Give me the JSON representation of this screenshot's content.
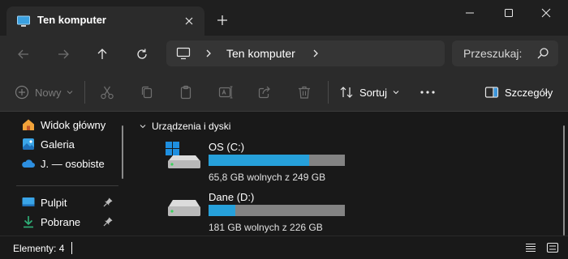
{
  "window": {
    "tab_title": "Ten komputer",
    "new_tab_symbol": "+",
    "icons": {
      "tab": "this-pc-icon",
      "close": "close-icon",
      "minimize": "minimize-icon",
      "maximize": "maximize-icon",
      "chevron": "chevron-down-icon"
    }
  },
  "nav": {
    "address": {
      "location": "Ten komputer"
    },
    "search_placeholder": "Przeszukaj:",
    "icons": [
      "back-arrow-icon",
      "forward-arrow-icon",
      "up-arrow-icon",
      "refresh-icon"
    ]
  },
  "toolbar": {
    "new_label": "Nowy",
    "sort_label": "Sortuj",
    "details_label": "Szczegóły",
    "disabled_icons": [
      "cut-icon",
      "copy-icon",
      "paste-icon",
      "rename-icon",
      "share-icon",
      "delete-icon"
    ]
  },
  "sidebar": {
    "items": [
      {
        "label": "Widok główny",
        "icon": "home-icon"
      },
      {
        "label": "Galeria",
        "icon": "gallery-icon"
      },
      {
        "label": "J. — osobiste",
        "icon": "onedrive-icon"
      }
    ],
    "pinned": [
      {
        "label": "Pulpit",
        "icon": "desktop-icon"
      },
      {
        "label": "Pobrane",
        "icon": "downloads-icon"
      }
    ]
  },
  "main": {
    "group_label": "Urządzenia i dyski",
    "drives": [
      {
        "name": "OS (C:)",
        "free_text": "65,8 GB wolnych z 249 GB",
        "used_fraction": 0.736,
        "icon": "system-drive-icon"
      },
      {
        "name": "Dane (D:)",
        "free_text": "181 GB wolnych z 226 GB",
        "used_fraction": 0.199,
        "icon": "drive-icon"
      }
    ]
  },
  "status": {
    "items_text": "Elementy: 4"
  },
  "colors": {
    "accent": "#26a0da",
    "bar_track": "#838383",
    "background": "#191919",
    "panel": "#2b2b2b"
  }
}
